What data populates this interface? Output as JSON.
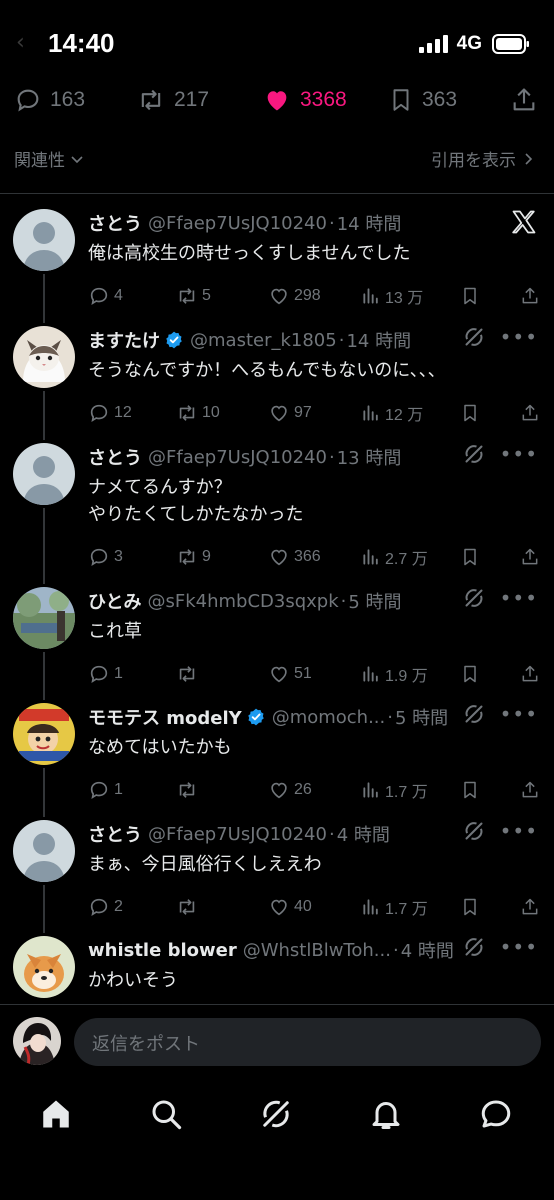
{
  "status_bar": {
    "time": "14:40",
    "network": "4G"
  },
  "engagement": {
    "replies": "163",
    "reposts": "217",
    "likes": "3368",
    "bookmarks": "363"
  },
  "sort": {
    "label": "関連性",
    "quotes_link": "引用を表示"
  },
  "replies": [
    {
      "name": "さとう",
      "handle": "@Ffaep7UsJQ10240",
      "sep": "·",
      "time": "14 時間",
      "verified": false,
      "text_lines": [
        "俺は高校生の時せっくすしませんでした"
      ],
      "reply_count": "4",
      "repost_count": "5",
      "like_count": "298",
      "view_count": "13 万",
      "menu_icon": "x-logo-icon"
    },
    {
      "name": "ますたけ",
      "handle": "@master_k1805",
      "sep": "·",
      "time": "14 時間",
      "verified": true,
      "text_lines": [
        "そうなんですか！へるもんでもないのに、、、"
      ],
      "reply_count": "12",
      "repost_count": "10",
      "like_count": "97",
      "view_count": "12 万",
      "menu_icon": "grok-icon"
    },
    {
      "name": "さとう",
      "handle": "@Ffaep7UsJQ10240",
      "sep": "·",
      "time": "13 時間",
      "verified": false,
      "text_lines": [
        "ナメてるんすか？",
        "やりたくてしかたなかった"
      ],
      "reply_count": "3",
      "repost_count": "9",
      "like_count": "366",
      "view_count": "2.7 万",
      "menu_icon": "grok-icon"
    },
    {
      "name": "ひとみ",
      "handle": "@sFk4hmbCD3sqxpk",
      "sep": "·",
      "time": "5 時間",
      "verified": false,
      "text_lines": [
        "これ草"
      ],
      "reply_count": "1",
      "repost_count": "",
      "like_count": "51",
      "view_count": "1.9 万",
      "menu_icon": "grok-icon"
    },
    {
      "name": "モモテス modelY",
      "handle": "@momoch...",
      "sep": "·",
      "time": "5 時間",
      "verified": true,
      "text_lines": [
        "なめてはいたかも"
      ],
      "reply_count": "1",
      "repost_count": "",
      "like_count": "26",
      "view_count": "1.7 万",
      "menu_icon": "grok-icon"
    },
    {
      "name": "さとう",
      "handle": "@Ffaep7UsJQ10240",
      "sep": "·",
      "time": "4 時間",
      "verified": false,
      "text_lines": [
        "まぁ、今日風俗行くしええわ"
      ],
      "reply_count": "2",
      "repost_count": "",
      "like_count": "40",
      "view_count": "1.7 万",
      "menu_icon": "grok-icon"
    },
    {
      "name": "whistle blower",
      "handle": "@WhstlBlwToh...",
      "sep": "·",
      "time": "4 時間",
      "verified": false,
      "text_lines": [
        "かわいそう"
      ],
      "reply_count": "",
      "repost_count": "",
      "like_count": "",
      "view_count": "",
      "menu_icon": "grok-icon"
    }
  ],
  "compose": {
    "placeholder": "返信をポスト"
  },
  "tabs": [
    "home-icon",
    "search-icon",
    "grok-icon",
    "notifications-icon",
    "messages-icon"
  ],
  "colors": {
    "background": "#000000",
    "text": "#e7e9ea",
    "muted": "#71767b",
    "like": "#f91880",
    "verified": "#1d9bf0"
  }
}
